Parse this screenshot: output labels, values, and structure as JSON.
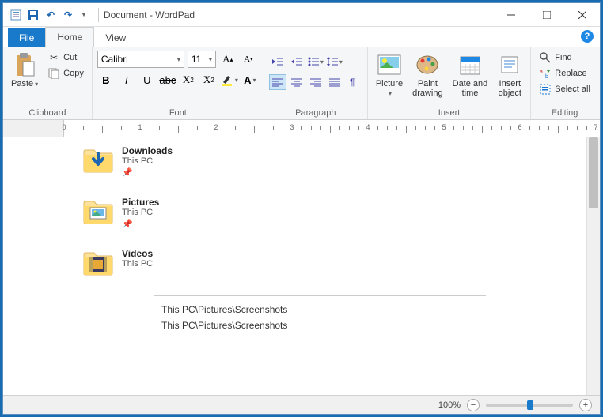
{
  "title": "Document - WordPad",
  "tabs": {
    "file": "File",
    "home": "Home",
    "view": "View"
  },
  "clipboard": {
    "paste": "Paste",
    "cut": "Cut",
    "copy": "Copy",
    "label": "Clipboard"
  },
  "font": {
    "name": "Calibri",
    "size": "11",
    "label": "Font"
  },
  "paragraph": {
    "label": "Paragraph"
  },
  "insert": {
    "picture": "Picture",
    "paint": "Paint\ndrawing",
    "datetime": "Date and\ntime",
    "object": "Insert\nobject",
    "label": "Insert"
  },
  "editing": {
    "find": "Find",
    "replace": "Replace",
    "selectall": "Select all",
    "label": "Editing"
  },
  "folders": [
    {
      "name": "Downloads",
      "sub": "This PC",
      "pinned": true,
      "variant": "download"
    },
    {
      "name": "Pictures",
      "sub": "This PC",
      "pinned": true,
      "variant": "pictures"
    },
    {
      "name": "Videos",
      "sub": "This PC",
      "pinned": false,
      "variant": "videos"
    }
  ],
  "paths": [
    "This PC\\Pictures\\Screenshots",
    "This PC\\Pictures\\Screenshots"
  ],
  "status": {
    "zoom": "100%"
  }
}
